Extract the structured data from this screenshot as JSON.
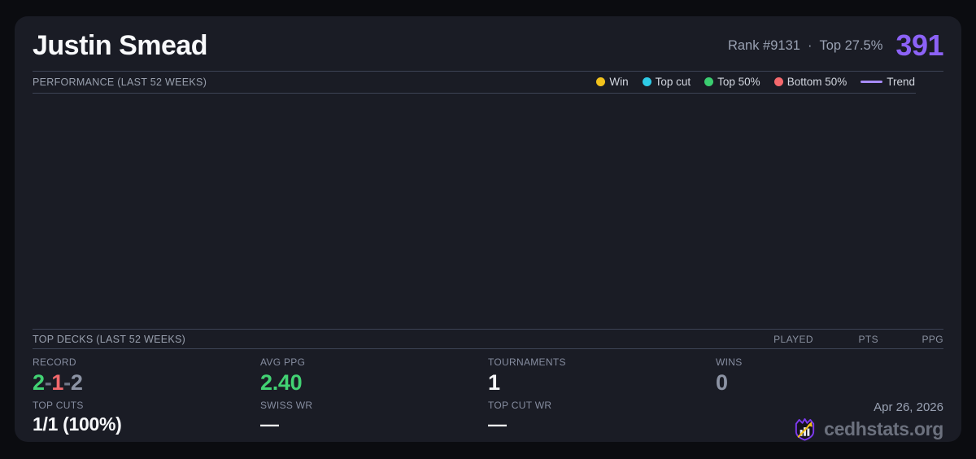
{
  "header": {
    "player_name": "Justin Smead",
    "rank": "Rank #9131",
    "separator": "·",
    "top_percent": "Top 27.5%",
    "score": "391"
  },
  "performance": {
    "section_title": "PERFORMANCE (LAST 52 WEEKS)",
    "legend": [
      {
        "label": "Win",
        "color": "#f2c21c"
      },
      {
        "label": "Top cut",
        "color": "#2ecbe6"
      },
      {
        "label": "Top 50%",
        "color": "#3bcd70"
      },
      {
        "label": "Bottom 50%",
        "color": "#f5696d"
      },
      {
        "label": "Trend",
        "color": "#a78bfa"
      }
    ],
    "chart_empty": true
  },
  "top_decks": {
    "section_title": "TOP DECKS (LAST 52 WEEKS)",
    "columns": [
      "PLAYED",
      "PTS",
      "PPG"
    ],
    "rows": []
  },
  "stats": {
    "record": {
      "label": "RECORD",
      "wins": "2",
      "losses": "1",
      "draws": "2",
      "separator": "-"
    },
    "avg_ppg": {
      "label": "AVG PPG",
      "value": "2.40"
    },
    "tournaments": {
      "label": "TOURNAMENTS",
      "value": "1"
    },
    "wins": {
      "label": "WINS",
      "value": "0"
    },
    "top_cuts": {
      "label": "TOP CUTS",
      "value": "1/1 (100%)"
    },
    "swiss_wr": {
      "label": "SWISS WR",
      "value": "—"
    },
    "top_cut_wr": {
      "label": "TOP CUT WR",
      "value": "—"
    }
  },
  "footer": {
    "date": "Apr 26, 2026",
    "site_name": "cedhstats.org"
  },
  "colors": {
    "accent_purple": "#8c62f6",
    "green": "#42d273",
    "red": "#f4696d",
    "gray_value": "#8c93a4",
    "card_bg": "#1a1c25",
    "page_bg": "#0b0c10",
    "divider": "#3d4355"
  }
}
